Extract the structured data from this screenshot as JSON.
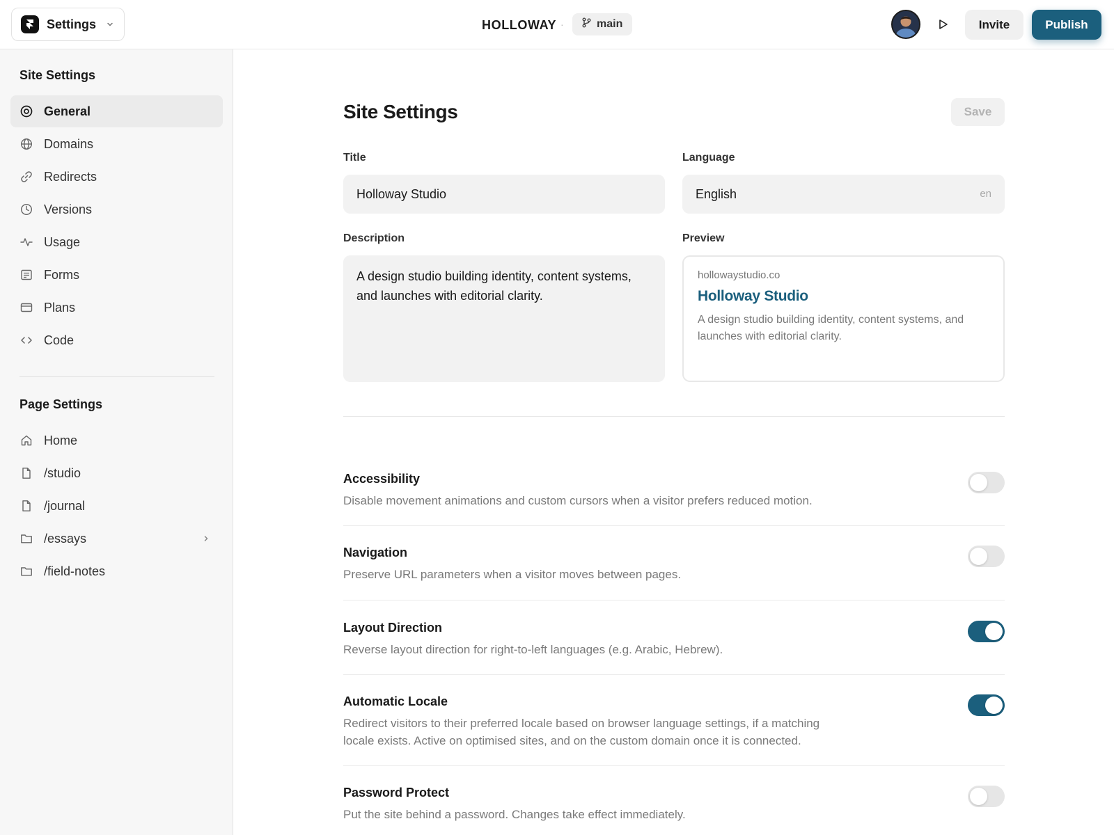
{
  "topbar": {
    "app_switcher_label": "Settings",
    "project_name": "HOLLOWAY",
    "separator": "·",
    "branch": "main",
    "invite_label": "Invite",
    "publish_label": "Publish"
  },
  "sidebar": {
    "site_heading": "Site Settings",
    "site_items": [
      {
        "label": "General",
        "icon": "target-icon",
        "active": true
      },
      {
        "label": "Domains",
        "icon": "globe-icon"
      },
      {
        "label": "Redirects",
        "icon": "link-icon"
      },
      {
        "label": "Versions",
        "icon": "clock-icon"
      },
      {
        "label": "Usage",
        "icon": "activity-icon"
      },
      {
        "label": "Forms",
        "icon": "form-icon"
      },
      {
        "label": "Plans",
        "icon": "credit-card-icon"
      },
      {
        "label": "Code",
        "icon": "code-icon"
      }
    ],
    "page_heading": "Page Settings",
    "page_items": [
      {
        "label": "Home",
        "icon": "home-icon"
      },
      {
        "label": "/studio",
        "icon": "file-icon"
      },
      {
        "label": "/journal",
        "icon": "file-icon"
      },
      {
        "label": "/essays",
        "icon": "folder-icon",
        "has_children": true
      },
      {
        "label": "/field-notes",
        "icon": "folder-icon"
      }
    ]
  },
  "main": {
    "title": "Site Settings",
    "save_label": "Save",
    "title_field": {
      "label": "Title",
      "value": "Holloway Studio"
    },
    "language_field": {
      "label": "Language",
      "value": "English",
      "code": "en"
    },
    "description_field": {
      "label": "Description",
      "value": "A design studio building identity, content systems, and launches with editorial clarity."
    },
    "preview": {
      "label": "Preview",
      "url": "hollowaystudio.co",
      "title": "Holloway Studio",
      "description": "A design studio building identity, content systems, and launches with editorial clarity."
    },
    "settings": [
      {
        "title": "Accessibility",
        "description": "Disable movement animations and custom cursors when a visitor prefers reduced motion.",
        "enabled": false
      },
      {
        "title": "Navigation",
        "description": "Preserve URL parameters when a visitor moves between pages.",
        "enabled": false
      },
      {
        "title": "Layout Direction",
        "description": "Reverse layout direction for right-to-left languages (e.g. Arabic, Hebrew).",
        "enabled": true
      },
      {
        "title": "Automatic Locale",
        "description": "Redirect visitors to their preferred locale based on browser language settings, if a matching locale exists. Active on optimised sites, and on the custom domain once it is connected.",
        "enabled": true
      },
      {
        "title": "Password Protect",
        "description": "Put the site behind a password. Changes take effect immediately.",
        "enabled": false
      }
    ]
  },
  "colors": {
    "accent": "#1b5f7d",
    "sidebar_bg": "#f7f7f7",
    "field_bg": "#f2f2f2",
    "muted_text": "#7a7a7a"
  }
}
